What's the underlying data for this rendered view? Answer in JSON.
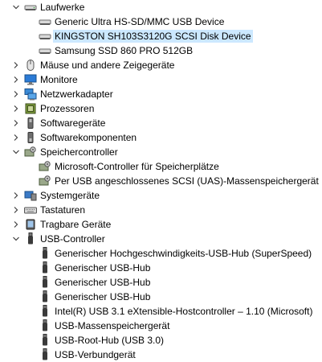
{
  "tree": {
    "rows": [
      {
        "label": "Laufwerke",
        "icon": "drive-category-icon",
        "level": 0,
        "expander": "expanded",
        "selected": false
      },
      {
        "label": "Generic Ultra HS-SD/MMC USB Device",
        "icon": "disk-drive-icon",
        "level": 1,
        "expander": "none",
        "selected": false
      },
      {
        "label": "KINGSTON  SH103S3120G SCSI Disk Device",
        "icon": "disk-drive-icon",
        "level": 1,
        "expander": "none",
        "selected": true
      },
      {
        "label": "Samsung SSD 860 PRO 512GB",
        "icon": "disk-drive-icon",
        "level": 1,
        "expander": "none",
        "selected": false
      },
      {
        "label": "Mäuse und andere Zeigegeräte",
        "icon": "mouse-icon",
        "level": 0,
        "expander": "collapsed",
        "selected": false
      },
      {
        "label": "Monitore",
        "icon": "monitor-icon",
        "level": 0,
        "expander": "collapsed",
        "selected": false
      },
      {
        "label": "Netzwerkadapter",
        "icon": "network-adapter-icon",
        "level": 0,
        "expander": "collapsed",
        "selected": false
      },
      {
        "label": "Prozessoren",
        "icon": "processor-icon",
        "level": 0,
        "expander": "collapsed",
        "selected": false
      },
      {
        "label": "Softwaregeräte",
        "icon": "software-device-icon",
        "level": 0,
        "expander": "collapsed",
        "selected": false
      },
      {
        "label": "Softwarekomponenten",
        "icon": "software-component-icon",
        "level": 0,
        "expander": "collapsed",
        "selected": false
      },
      {
        "label": "Speichercontroller",
        "icon": "storage-controller-icon",
        "level": 0,
        "expander": "expanded",
        "selected": false
      },
      {
        "label": "Microsoft-Controller für Speicherplätze",
        "icon": "storage-controller-icon",
        "level": 1,
        "expander": "none",
        "selected": false
      },
      {
        "label": "Per USB angeschlossenes SCSI (UAS)-Massenspeichergerät",
        "icon": "storage-controller-icon",
        "level": 1,
        "expander": "none",
        "selected": false
      },
      {
        "label": "Systemgeräte",
        "icon": "system-device-icon",
        "level": 0,
        "expander": "collapsed",
        "selected": false
      },
      {
        "label": "Tastaturen",
        "icon": "keyboard-icon",
        "level": 0,
        "expander": "collapsed",
        "selected": false
      },
      {
        "label": "Tragbare Geräte",
        "icon": "portable-device-icon",
        "level": 0,
        "expander": "collapsed",
        "selected": false
      },
      {
        "label": "USB-Controller",
        "icon": "usb-icon",
        "level": 0,
        "expander": "expanded",
        "selected": false
      },
      {
        "label": "Generischer Hochgeschwindigkeits-USB-Hub (SuperSpeed)",
        "icon": "usb-icon",
        "level": 1,
        "expander": "none",
        "selected": false
      },
      {
        "label": "Generischer USB-Hub",
        "icon": "usb-icon",
        "level": 1,
        "expander": "none",
        "selected": false
      },
      {
        "label": "Generischer USB-Hub",
        "icon": "usb-icon",
        "level": 1,
        "expander": "none",
        "selected": false
      },
      {
        "label": "Generischer USB-Hub",
        "icon": "usb-icon",
        "level": 1,
        "expander": "none",
        "selected": false
      },
      {
        "label": "Intel(R) USB 3.1 eXtensible-Hostcontroller – 1.10 (Microsoft)",
        "icon": "usb-icon",
        "level": 1,
        "expander": "none",
        "selected": false
      },
      {
        "label": "USB-Massenspeichergerät",
        "icon": "usb-icon",
        "level": 1,
        "expander": "none",
        "selected": false
      },
      {
        "label": "USB-Root-Hub (USB 3.0)",
        "icon": "usb-icon",
        "level": 1,
        "expander": "none",
        "selected": false
      },
      {
        "label": "USB-Verbundgerät",
        "icon": "usb-icon",
        "level": 1,
        "expander": "none",
        "selected": false
      }
    ]
  },
  "colors": {
    "selection": "#cce8ff",
    "expander": "#404040"
  }
}
